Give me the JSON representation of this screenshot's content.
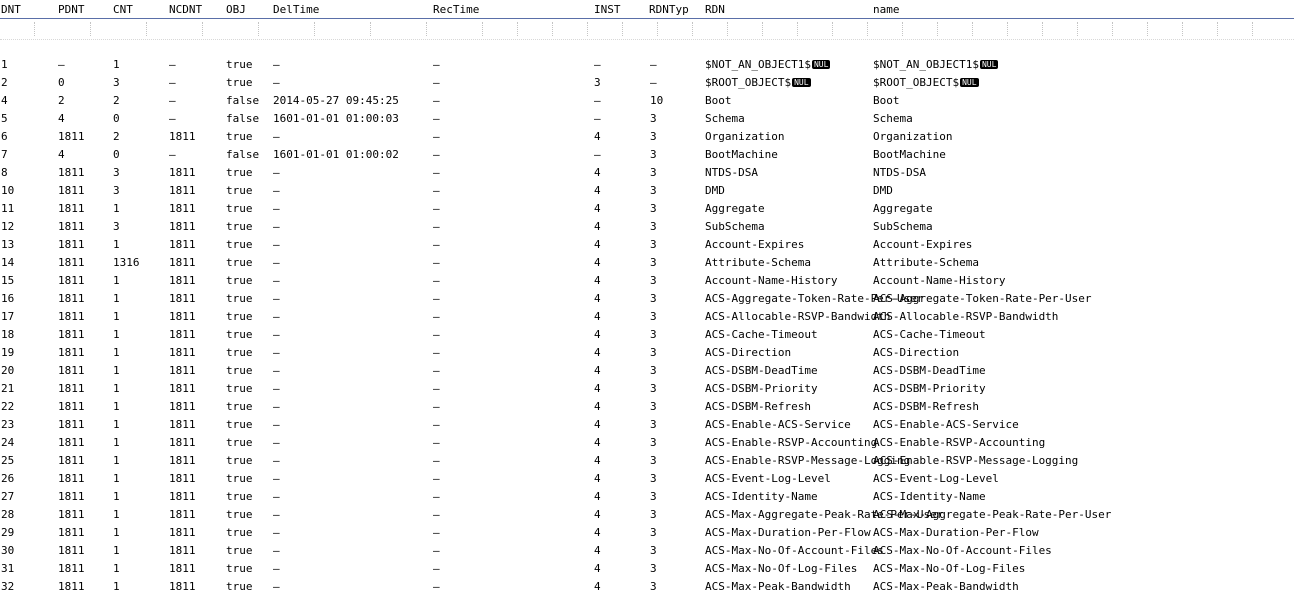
{
  "columns": [
    "DNT",
    "PDNT",
    "CNT",
    "NCDNT",
    "OBJ",
    "DelTime",
    "RecTime",
    "INST",
    "RDNTyp",
    "RDN",
    "name"
  ],
  "nul_badge": "NUL",
  "rows": [
    {
      "dnt": "1",
      "pdnt": "–",
      "cnt": "1",
      "ncdnt": "–",
      "obj": "true",
      "deltime": "–",
      "rectime": "–",
      "inst": "–",
      "rdntyp": "–",
      "rdn": "$NOT_AN_OBJECT1$",
      "rdn_nul": true,
      "name": "$NOT_AN_OBJECT1$",
      "name_nul": true
    },
    {
      "dnt": "2",
      "pdnt": "0",
      "cnt": "3",
      "ncdnt": "–",
      "obj": "true",
      "deltime": "–",
      "rectime": "–",
      "inst": "3",
      "rdntyp": "–",
      "rdn": "$ROOT_OBJECT$",
      "rdn_nul": true,
      "name": "$ROOT_OBJECT$",
      "name_nul": true
    },
    {
      "dnt": "4",
      "pdnt": "2",
      "cnt": "2",
      "ncdnt": "–",
      "obj": "false",
      "deltime": "2014-05-27 09:45:25",
      "rectime": "–",
      "inst": "–",
      "rdntyp": "10",
      "rdn": "Boot",
      "name": "Boot"
    },
    {
      "dnt": "5",
      "pdnt": "4",
      "cnt": "0",
      "ncdnt": "–",
      "obj": "false",
      "deltime": "1601-01-01 01:00:03",
      "rectime": "–",
      "inst": "–",
      "rdntyp": "3",
      "rdn": "Schema",
      "name": "Schema"
    },
    {
      "dnt": "6",
      "pdnt": "1811",
      "cnt": "2",
      "ncdnt": "1811",
      "obj": "true",
      "deltime": "–",
      "rectime": "–",
      "inst": "4",
      "rdntyp": "3",
      "rdn": "Organization",
      "name": "Organization"
    },
    {
      "dnt": "7",
      "pdnt": "4",
      "cnt": "0",
      "ncdnt": "–",
      "obj": "false",
      "deltime": "1601-01-01 01:00:02",
      "rectime": "–",
      "inst": "–",
      "rdntyp": "3",
      "rdn": "BootMachine",
      "name": "BootMachine"
    },
    {
      "dnt": "8",
      "pdnt": "1811",
      "cnt": "3",
      "ncdnt": "1811",
      "obj": "true",
      "deltime": "–",
      "rectime": "–",
      "inst": "4",
      "rdntyp": "3",
      "rdn": "NTDS-DSA",
      "name": "NTDS-DSA"
    },
    {
      "dnt": "10",
      "pdnt": "1811",
      "cnt": "3",
      "ncdnt": "1811",
      "obj": "true",
      "deltime": "–",
      "rectime": "–",
      "inst": "4",
      "rdntyp": "3",
      "rdn": "DMD",
      "name": "DMD"
    },
    {
      "dnt": "11",
      "pdnt": "1811",
      "cnt": "1",
      "ncdnt": "1811",
      "obj": "true",
      "deltime": "–",
      "rectime": "–",
      "inst": "4",
      "rdntyp": "3",
      "rdn": "Aggregate",
      "name": "Aggregate"
    },
    {
      "dnt": "12",
      "pdnt": "1811",
      "cnt": "3",
      "ncdnt": "1811",
      "obj": "true",
      "deltime": "–",
      "rectime": "–",
      "inst": "4",
      "rdntyp": "3",
      "rdn": "SubSchema",
      "name": "SubSchema"
    },
    {
      "dnt": "13",
      "pdnt": "1811",
      "cnt": "1",
      "ncdnt": "1811",
      "obj": "true",
      "deltime": "–",
      "rectime": "–",
      "inst": "4",
      "rdntyp": "3",
      "rdn": "Account-Expires",
      "name": "Account-Expires"
    },
    {
      "dnt": "14",
      "pdnt": "1811",
      "cnt": "1316",
      "ncdnt": "1811",
      "obj": "true",
      "deltime": "–",
      "rectime": "–",
      "inst": "4",
      "rdntyp": "3",
      "rdn": "Attribute-Schema",
      "name": "Attribute-Schema"
    },
    {
      "dnt": "15",
      "pdnt": "1811",
      "cnt": "1",
      "ncdnt": "1811",
      "obj": "true",
      "deltime": "–",
      "rectime": "–",
      "inst": "4",
      "rdntyp": "3",
      "rdn": "Account-Name-History",
      "name": "Account-Name-History"
    },
    {
      "dnt": "16",
      "pdnt": "1811",
      "cnt": "1",
      "ncdnt": "1811",
      "obj": "true",
      "deltime": "–",
      "rectime": "–",
      "inst": "4",
      "rdntyp": "3",
      "rdn": "ACS-Aggregate-Token-Rate-Per-User",
      "name": "ACS-Aggregate-Token-Rate-Per-User"
    },
    {
      "dnt": "17",
      "pdnt": "1811",
      "cnt": "1",
      "ncdnt": "1811",
      "obj": "true",
      "deltime": "–",
      "rectime": "–",
      "inst": "4",
      "rdntyp": "3",
      "rdn": "ACS-Allocable-RSVP-Bandwidth",
      "name": "ACS-Allocable-RSVP-Bandwidth"
    },
    {
      "dnt": "18",
      "pdnt": "1811",
      "cnt": "1",
      "ncdnt": "1811",
      "obj": "true",
      "deltime": "–",
      "rectime": "–",
      "inst": "4",
      "rdntyp": "3",
      "rdn": "ACS-Cache-Timeout",
      "name": "ACS-Cache-Timeout"
    },
    {
      "dnt": "19",
      "pdnt": "1811",
      "cnt": "1",
      "ncdnt": "1811",
      "obj": "true",
      "deltime": "–",
      "rectime": "–",
      "inst": "4",
      "rdntyp": "3",
      "rdn": "ACS-Direction",
      "name": "ACS-Direction"
    },
    {
      "dnt": "20",
      "pdnt": "1811",
      "cnt": "1",
      "ncdnt": "1811",
      "obj": "true",
      "deltime": "–",
      "rectime": "–",
      "inst": "4",
      "rdntyp": "3",
      "rdn": "ACS-DSBM-DeadTime",
      "name": "ACS-DSBM-DeadTime"
    },
    {
      "dnt": "21",
      "pdnt": "1811",
      "cnt": "1",
      "ncdnt": "1811",
      "obj": "true",
      "deltime": "–",
      "rectime": "–",
      "inst": "4",
      "rdntyp": "3",
      "rdn": "ACS-DSBM-Priority",
      "name": "ACS-DSBM-Priority"
    },
    {
      "dnt": "22",
      "pdnt": "1811",
      "cnt": "1",
      "ncdnt": "1811",
      "obj": "true",
      "deltime": "–",
      "rectime": "–",
      "inst": "4",
      "rdntyp": "3",
      "rdn": "ACS-DSBM-Refresh",
      "name": "ACS-DSBM-Refresh"
    },
    {
      "dnt": "23",
      "pdnt": "1811",
      "cnt": "1",
      "ncdnt": "1811",
      "obj": "true",
      "deltime": "–",
      "rectime": "–",
      "inst": "4",
      "rdntyp": "3",
      "rdn": "ACS-Enable-ACS-Service",
      "name": "ACS-Enable-ACS-Service"
    },
    {
      "dnt": "24",
      "pdnt": "1811",
      "cnt": "1",
      "ncdnt": "1811",
      "obj": "true",
      "deltime": "–",
      "rectime": "–",
      "inst": "4",
      "rdntyp": "3",
      "rdn": "ACS-Enable-RSVP-Accounting",
      "name": "ACS-Enable-RSVP-Accounting"
    },
    {
      "dnt": "25",
      "pdnt": "1811",
      "cnt": "1",
      "ncdnt": "1811",
      "obj": "true",
      "deltime": "–",
      "rectime": "–",
      "inst": "4",
      "rdntyp": "3",
      "rdn": "ACS-Enable-RSVP-Message-Logging",
      "name": "ACS-Enable-RSVP-Message-Logging"
    },
    {
      "dnt": "26",
      "pdnt": "1811",
      "cnt": "1",
      "ncdnt": "1811",
      "obj": "true",
      "deltime": "–",
      "rectime": "–",
      "inst": "4",
      "rdntyp": "3",
      "rdn": "ACS-Event-Log-Level",
      "name": "ACS-Event-Log-Level"
    },
    {
      "dnt": "27",
      "pdnt": "1811",
      "cnt": "1",
      "ncdnt": "1811",
      "obj": "true",
      "deltime": "–",
      "rectime": "–",
      "inst": "4",
      "rdntyp": "3",
      "rdn": "ACS-Identity-Name",
      "name": "ACS-Identity-Name"
    },
    {
      "dnt": "28",
      "pdnt": "1811",
      "cnt": "1",
      "ncdnt": "1811",
      "obj": "true",
      "deltime": "–",
      "rectime": "–",
      "inst": "4",
      "rdntyp": "3",
      "rdn": "ACS-Max-Aggregate-Peak-Rate-Per-User",
      "name": "ACS-Max-Aggregate-Peak-Rate-Per-User"
    },
    {
      "dnt": "29",
      "pdnt": "1811",
      "cnt": "1",
      "ncdnt": "1811",
      "obj": "true",
      "deltime": "–",
      "rectime": "–",
      "inst": "4",
      "rdntyp": "3",
      "rdn": "ACS-Max-Duration-Per-Flow",
      "name": "ACS-Max-Duration-Per-Flow"
    },
    {
      "dnt": "30",
      "pdnt": "1811",
      "cnt": "1",
      "ncdnt": "1811",
      "obj": "true",
      "deltime": "–",
      "rectime": "–",
      "inst": "4",
      "rdntyp": "3",
      "rdn": "ACS-Max-No-Of-Account-Files",
      "name": "ACS-Max-No-Of-Account-Files"
    },
    {
      "dnt": "31",
      "pdnt": "1811",
      "cnt": "1",
      "ncdnt": "1811",
      "obj": "true",
      "deltime": "–",
      "rectime": "–",
      "inst": "4",
      "rdntyp": "3",
      "rdn": "ACS-Max-No-Of-Log-Files",
      "name": "ACS-Max-No-Of-Log-Files"
    },
    {
      "dnt": "32",
      "pdnt": "1811",
      "cnt": "1",
      "ncdnt": "1811",
      "obj": "true",
      "deltime": "–",
      "rectime": "–",
      "inst": "4",
      "rdntyp": "3",
      "rdn": "ACS-Max-Peak-Bandwidth",
      "name": "ACS-Max-Peak-Bandwidth"
    }
  ]
}
